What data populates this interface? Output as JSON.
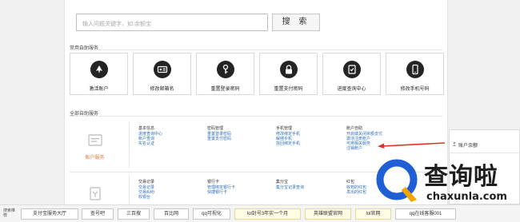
{
  "search": {
    "placeholder": "输入问题关键字，如:余额宝",
    "button_label": "搜 索"
  },
  "common_services": {
    "title": "常用自助服务",
    "tiles": [
      {
        "label": "激活账户",
        "icon": "account-activate-icon"
      },
      {
        "label": "修改邮箱名",
        "icon": "id-card-icon"
      },
      {
        "label": "重置登录密码",
        "icon": "key-icon"
      },
      {
        "label": "重置支付密码",
        "icon": "lock-icon"
      },
      {
        "label": "进度查询中心",
        "icon": "progress-icon"
      },
      {
        "label": "修改手机号码",
        "icon": "mobile-phone-icon"
      }
    ]
  },
  "all_services": {
    "title": "全部自助服务",
    "categories": [
      {
        "name": "账户服务",
        "columns": [
          {
            "heading": "基本信息",
            "links": [
              "进度查询中心",
              "账户查询",
              "实名认证"
            ]
          },
          {
            "heading": "密码管理",
            "links": [
              "重置登录密码",
              "重置支付密码"
            ]
          },
          {
            "heading": "手机管理",
            "links": [
              "修改绑定手机",
              "解绑手机",
              "找回绑定手机"
            ]
          },
          {
            "heading": "账户自助",
            "links": [
              "开启或关闭余额支付",
              "激活注册账户",
              "可用相关服务",
              "注销账户"
            ]
          }
        ]
      },
      {
        "name": "",
        "columns": [
          {
            "heading": "交易记录",
            "links": [
              "交易记录",
              "交易纠纷",
              "收银台"
            ]
          },
          {
            "heading": "银行卡",
            "links": [
              "管理绑定银行卡",
              "快捷银行卡"
            ]
          },
          {
            "heading": "集分宝",
            "links": [
              "集分宝记录查询"
            ]
          },
          {
            "heading": "红包",
            "links": [
              "收到的红包",
              "发出的红包"
            ]
          }
        ]
      }
    ]
  },
  "side_popup": {
    "title": "账户余额"
  },
  "watermark": {
    "text": "查询啦",
    "domain": "chaxunla.com"
  },
  "bottom_bar": {
    "label": "搜索推荐",
    "chips": [
      "支付宝服务大厅",
      "查号吧",
      "三百搜",
      "百比网",
      "qq可视化",
      "lol封号3年实一个月",
      "英雄联盟官网",
      "lol官网",
      "qq在线客服001"
    ]
  },
  "colors": {
    "accent_orange": "#e37a44",
    "link_blue": "#2f6fb8",
    "arrow_red": "#e0302a",
    "icon_dark": "#242424"
  }
}
